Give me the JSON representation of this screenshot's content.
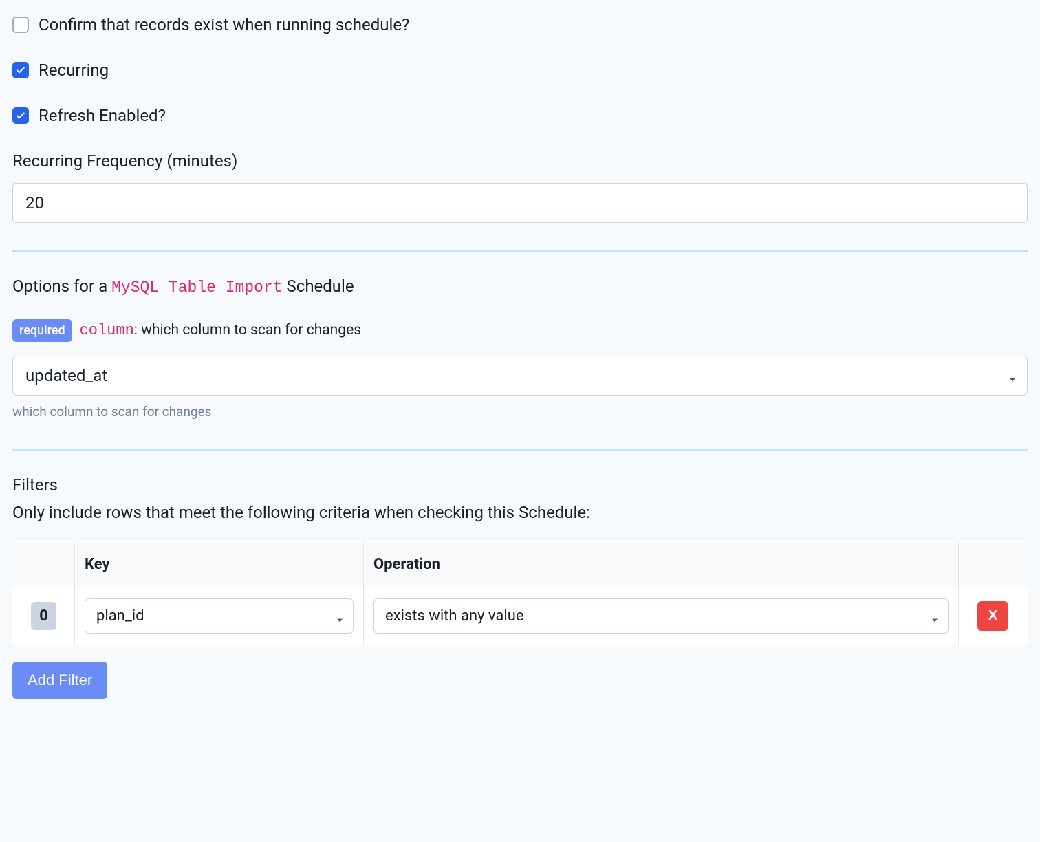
{
  "checkboxes": {
    "confirm_records": {
      "label": "Confirm that records exist when running schedule?",
      "checked": false
    },
    "recurring": {
      "label": "Recurring",
      "checked": true
    },
    "refresh_enabled": {
      "label": "Refresh Enabled?",
      "checked": true
    }
  },
  "recurring_frequency": {
    "label": "Recurring Frequency (minutes)",
    "value": "20"
  },
  "options_section": {
    "prefix": "Options for a ",
    "code": "MySQL Table Import",
    "suffix": " Schedule",
    "required_badge": "required",
    "column_code": "column",
    "column_desc": ": which column to scan for changes",
    "column_select": {
      "value": "updated_at"
    },
    "help_text": "which column to scan for changes"
  },
  "filters_section": {
    "title": "Filters",
    "desc": "Only include rows that meet the following criteria when checking this Schedule:",
    "headers": {
      "key": "Key",
      "operation": "Operation"
    },
    "rows": [
      {
        "index": "0",
        "key": "plan_id",
        "operation": "exists with any value"
      }
    ],
    "delete_label": "X",
    "add_filter_label": "Add Filter"
  }
}
